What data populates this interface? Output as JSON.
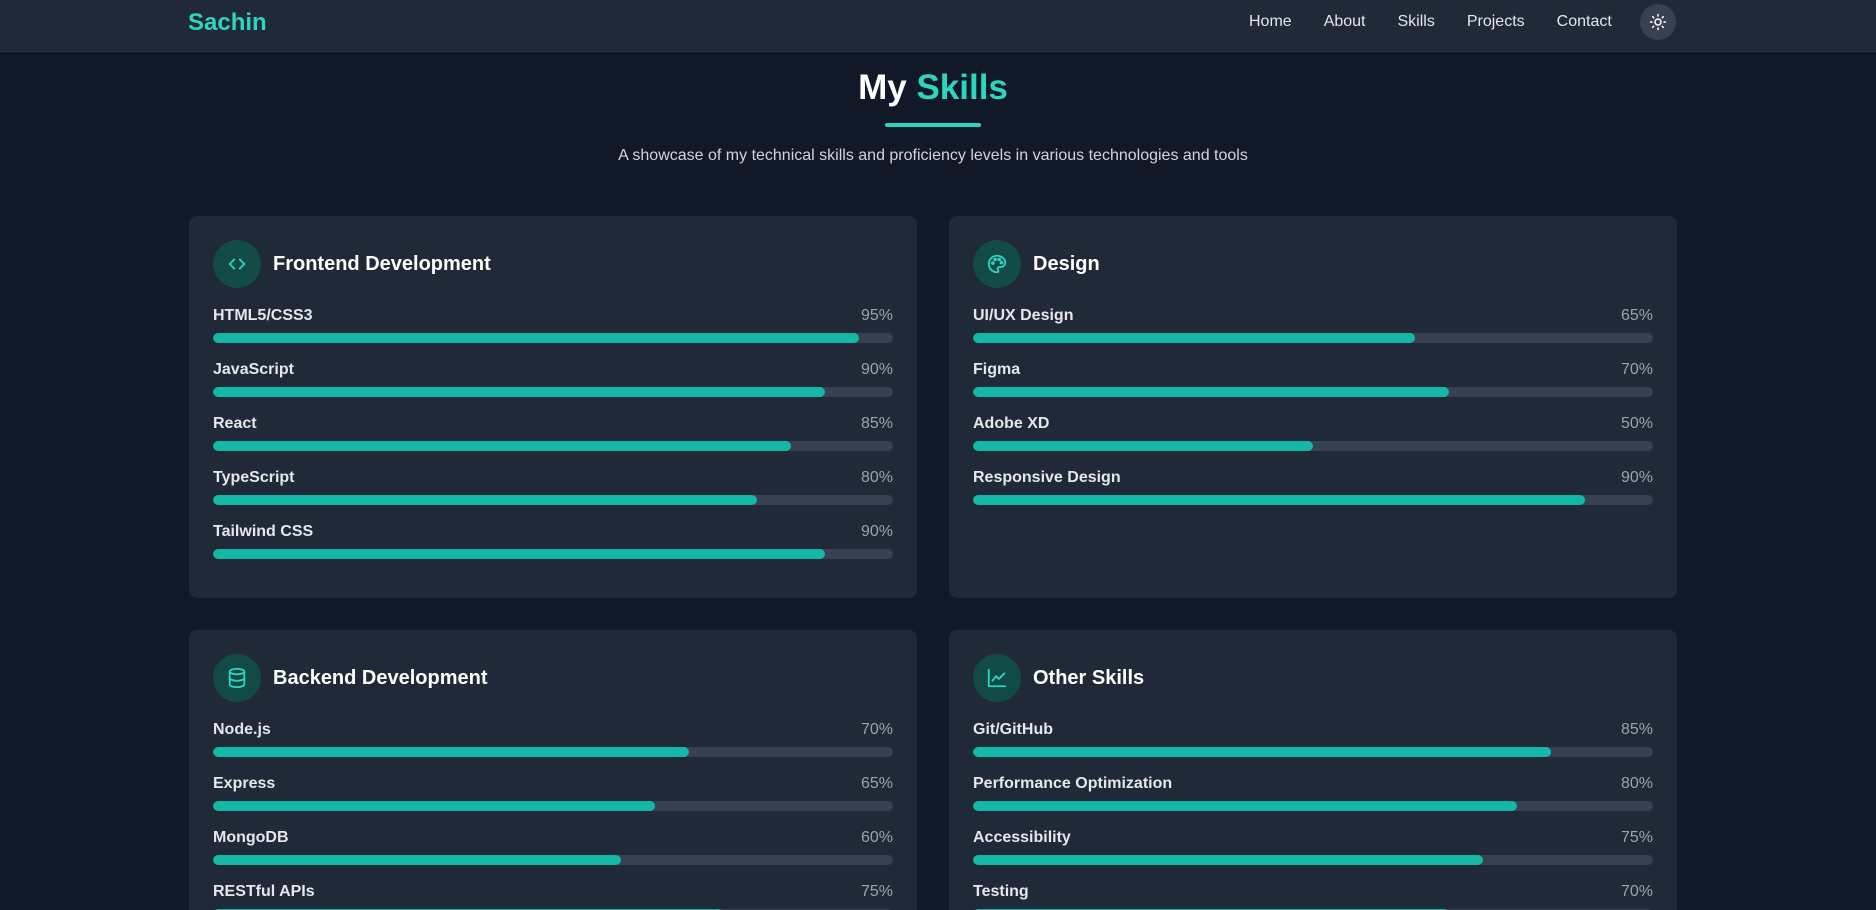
{
  "nav": {
    "brand": "Sachin",
    "links": [
      "Home",
      "About",
      "Skills",
      "Projects",
      "Contact"
    ],
    "theme_icon": "sun-icon"
  },
  "hero": {
    "title_prefix": "My",
    "title_accent": "Skills",
    "subtitle": "A showcase of my technical skills and proficiency levels in various technologies and tools"
  },
  "colors": {
    "accent": "#2dd4bf",
    "bar_fill": "#14b8a6",
    "background": "#111827",
    "card": "#1f2937"
  },
  "cards": [
    {
      "title": "Frontend Development",
      "icon": "code-icon",
      "skills": [
        {
          "name": "HTML5/CSS3",
          "percent": "95%",
          "level": 95
        },
        {
          "name": "JavaScript",
          "percent": "90%",
          "level": 90
        },
        {
          "name": "React",
          "percent": "85%",
          "level": 85
        },
        {
          "name": "TypeScript",
          "percent": "80%",
          "level": 80
        },
        {
          "name": "Tailwind CSS",
          "percent": "90%",
          "level": 90
        }
      ]
    },
    {
      "title": "Design",
      "icon": "palette-icon",
      "skills": [
        {
          "name": "UI/UX Design",
          "percent": "65%",
          "level": 65
        },
        {
          "name": "Figma",
          "percent": "70%",
          "level": 70
        },
        {
          "name": "Adobe XD",
          "percent": "50%",
          "level": 50
        },
        {
          "name": "Responsive Design",
          "percent": "90%",
          "level": 90
        }
      ]
    },
    {
      "title": "Backend Development",
      "icon": "database-icon",
      "skills": [
        {
          "name": "Node.js",
          "percent": "70%",
          "level": 70
        },
        {
          "name": "Express",
          "percent": "65%",
          "level": 65
        },
        {
          "name": "MongoDB",
          "percent": "60%",
          "level": 60
        },
        {
          "name": "RESTful APIs",
          "percent": "75%",
          "level": 75
        }
      ]
    },
    {
      "title": "Other Skills",
      "icon": "line-chart-icon",
      "skills": [
        {
          "name": "Git/GitHub",
          "percent": "85%",
          "level": 85
        },
        {
          "name": "Performance Optimization",
          "percent": "80%",
          "level": 80
        },
        {
          "name": "Accessibility",
          "percent": "75%",
          "level": 75
        },
        {
          "name": "Testing",
          "percent": "70%",
          "level": 70
        }
      ]
    }
  ]
}
